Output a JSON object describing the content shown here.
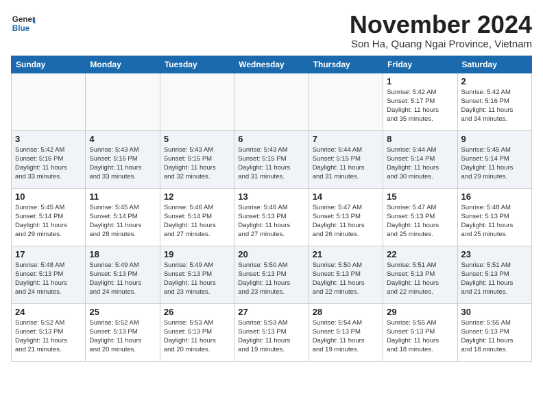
{
  "logo": {
    "text_general": "General",
    "text_blue": "Blue"
  },
  "title": "November 2024",
  "subtitle": "Son Ha, Quang Ngai Province, Vietnam",
  "headers": [
    "Sunday",
    "Monday",
    "Tuesday",
    "Wednesday",
    "Thursday",
    "Friday",
    "Saturday"
  ],
  "weeks": [
    {
      "shaded": false,
      "days": [
        {
          "num": "",
          "info": ""
        },
        {
          "num": "",
          "info": ""
        },
        {
          "num": "",
          "info": ""
        },
        {
          "num": "",
          "info": ""
        },
        {
          "num": "",
          "info": ""
        },
        {
          "num": "1",
          "info": "Sunrise: 5:42 AM\nSunset: 5:17 PM\nDaylight: 11 hours\nand 35 minutes."
        },
        {
          "num": "2",
          "info": "Sunrise: 5:42 AM\nSunset: 5:16 PM\nDaylight: 11 hours\nand 34 minutes."
        }
      ]
    },
    {
      "shaded": true,
      "days": [
        {
          "num": "3",
          "info": "Sunrise: 5:42 AM\nSunset: 5:16 PM\nDaylight: 11 hours\nand 33 minutes."
        },
        {
          "num": "4",
          "info": "Sunrise: 5:43 AM\nSunset: 5:16 PM\nDaylight: 11 hours\nand 33 minutes."
        },
        {
          "num": "5",
          "info": "Sunrise: 5:43 AM\nSunset: 5:15 PM\nDaylight: 11 hours\nand 32 minutes."
        },
        {
          "num": "6",
          "info": "Sunrise: 5:43 AM\nSunset: 5:15 PM\nDaylight: 11 hours\nand 31 minutes."
        },
        {
          "num": "7",
          "info": "Sunrise: 5:44 AM\nSunset: 5:15 PM\nDaylight: 11 hours\nand 31 minutes."
        },
        {
          "num": "8",
          "info": "Sunrise: 5:44 AM\nSunset: 5:14 PM\nDaylight: 11 hours\nand 30 minutes."
        },
        {
          "num": "9",
          "info": "Sunrise: 5:45 AM\nSunset: 5:14 PM\nDaylight: 11 hours\nand 29 minutes."
        }
      ]
    },
    {
      "shaded": false,
      "days": [
        {
          "num": "10",
          "info": "Sunrise: 5:45 AM\nSunset: 5:14 PM\nDaylight: 11 hours\nand 29 minutes."
        },
        {
          "num": "11",
          "info": "Sunrise: 5:45 AM\nSunset: 5:14 PM\nDaylight: 11 hours\nand 28 minutes."
        },
        {
          "num": "12",
          "info": "Sunrise: 5:46 AM\nSunset: 5:14 PM\nDaylight: 11 hours\nand 27 minutes."
        },
        {
          "num": "13",
          "info": "Sunrise: 5:46 AM\nSunset: 5:13 PM\nDaylight: 11 hours\nand 27 minutes."
        },
        {
          "num": "14",
          "info": "Sunrise: 5:47 AM\nSunset: 5:13 PM\nDaylight: 11 hours\nand 26 minutes."
        },
        {
          "num": "15",
          "info": "Sunrise: 5:47 AM\nSunset: 5:13 PM\nDaylight: 11 hours\nand 25 minutes."
        },
        {
          "num": "16",
          "info": "Sunrise: 5:48 AM\nSunset: 5:13 PM\nDaylight: 11 hours\nand 25 minutes."
        }
      ]
    },
    {
      "shaded": true,
      "days": [
        {
          "num": "17",
          "info": "Sunrise: 5:48 AM\nSunset: 5:13 PM\nDaylight: 11 hours\nand 24 minutes."
        },
        {
          "num": "18",
          "info": "Sunrise: 5:49 AM\nSunset: 5:13 PM\nDaylight: 11 hours\nand 24 minutes."
        },
        {
          "num": "19",
          "info": "Sunrise: 5:49 AM\nSunset: 5:13 PM\nDaylight: 11 hours\nand 23 minutes."
        },
        {
          "num": "20",
          "info": "Sunrise: 5:50 AM\nSunset: 5:13 PM\nDaylight: 11 hours\nand 23 minutes."
        },
        {
          "num": "21",
          "info": "Sunrise: 5:50 AM\nSunset: 5:13 PM\nDaylight: 11 hours\nand 22 minutes."
        },
        {
          "num": "22",
          "info": "Sunrise: 5:51 AM\nSunset: 5:13 PM\nDaylight: 11 hours\nand 22 minutes."
        },
        {
          "num": "23",
          "info": "Sunrise: 5:51 AM\nSunset: 5:13 PM\nDaylight: 11 hours\nand 21 minutes."
        }
      ]
    },
    {
      "shaded": false,
      "days": [
        {
          "num": "24",
          "info": "Sunrise: 5:52 AM\nSunset: 5:13 PM\nDaylight: 11 hours\nand 21 minutes."
        },
        {
          "num": "25",
          "info": "Sunrise: 5:52 AM\nSunset: 5:13 PM\nDaylight: 11 hours\nand 20 minutes."
        },
        {
          "num": "26",
          "info": "Sunrise: 5:53 AM\nSunset: 5:13 PM\nDaylight: 11 hours\nand 20 minutes."
        },
        {
          "num": "27",
          "info": "Sunrise: 5:53 AM\nSunset: 5:13 PM\nDaylight: 11 hours\nand 19 minutes."
        },
        {
          "num": "28",
          "info": "Sunrise: 5:54 AM\nSunset: 5:13 PM\nDaylight: 11 hours\nand 19 minutes."
        },
        {
          "num": "29",
          "info": "Sunrise: 5:55 AM\nSunset: 5:13 PM\nDaylight: 11 hours\nand 18 minutes."
        },
        {
          "num": "30",
          "info": "Sunrise: 5:55 AM\nSunset: 5:13 PM\nDaylight: 11 hours\nand 18 minutes."
        }
      ]
    }
  ]
}
